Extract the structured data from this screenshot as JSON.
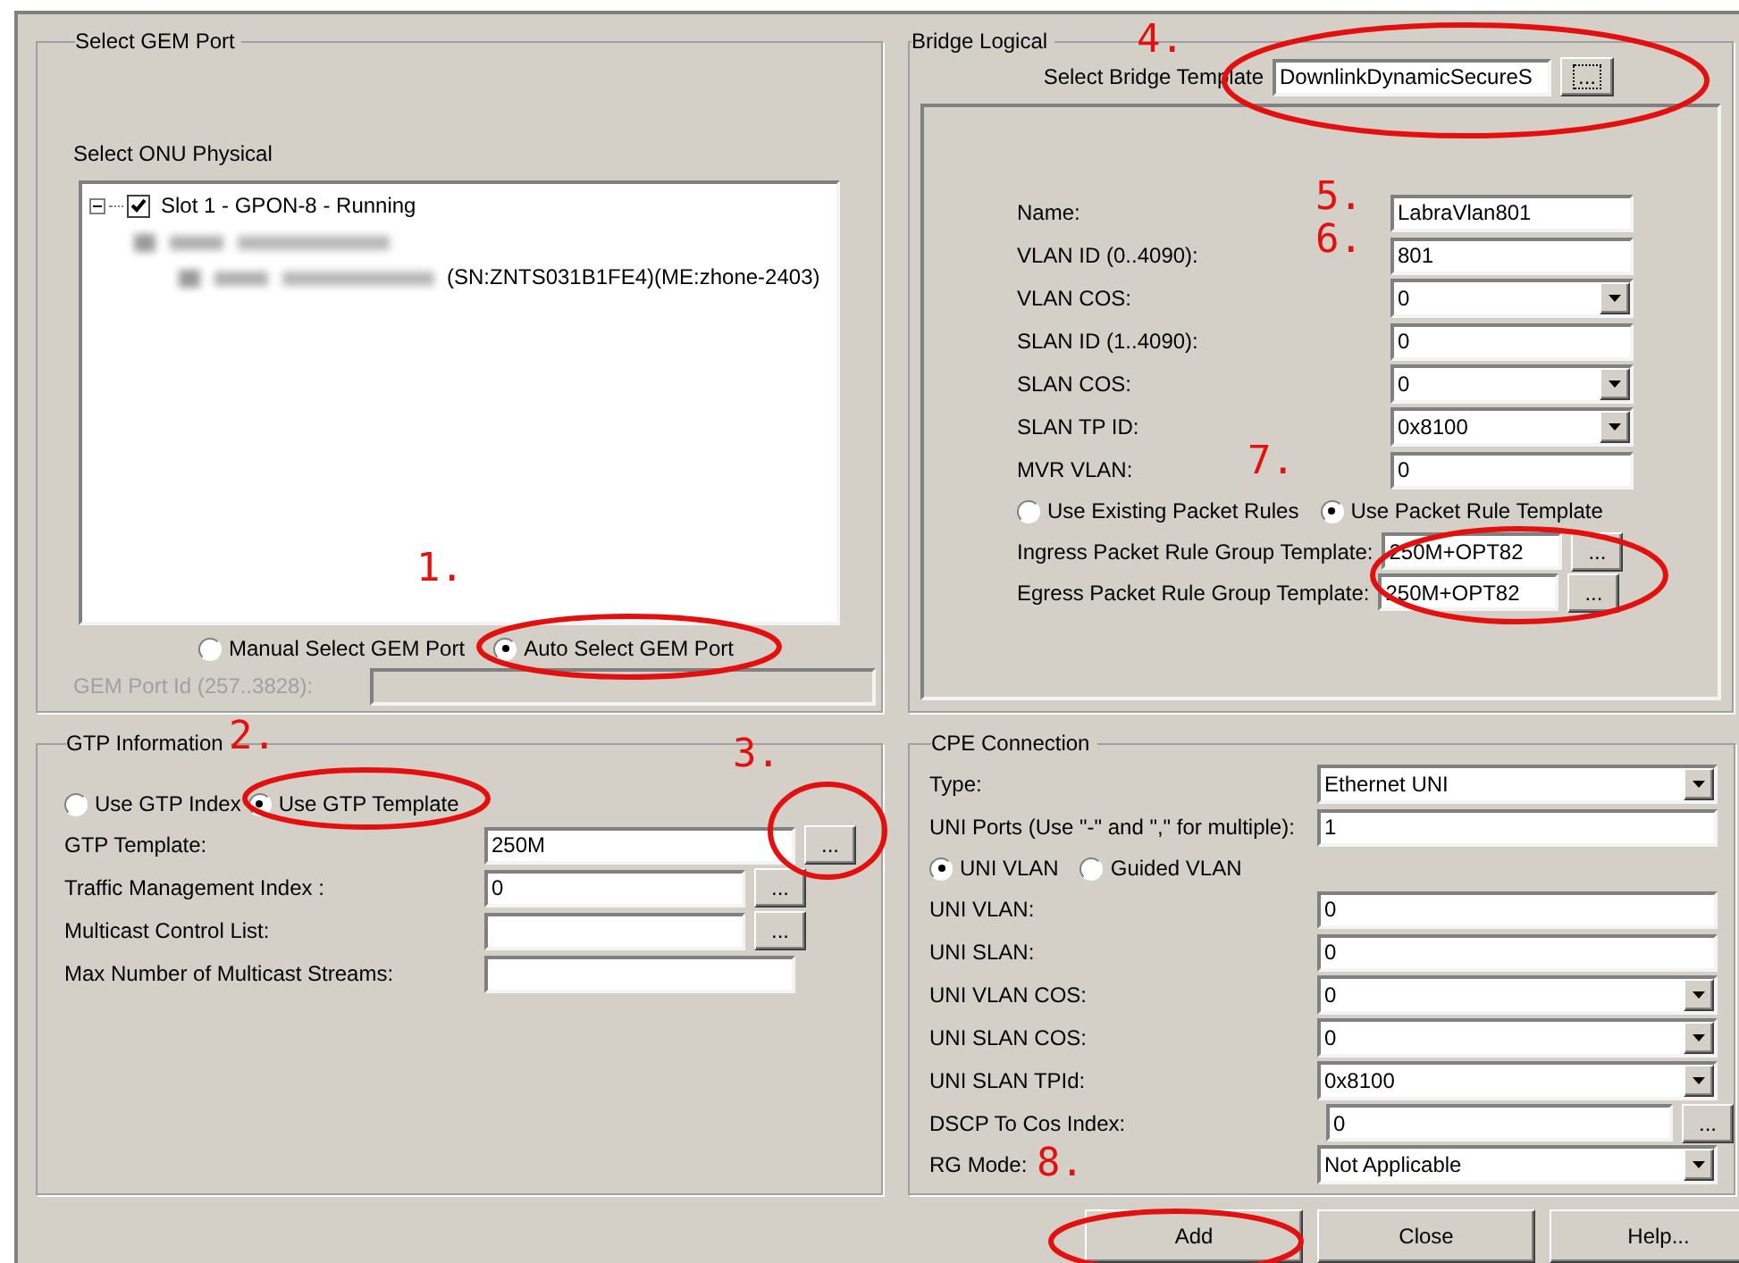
{
  "gem_port": {
    "title": "Select GEM Port",
    "tree_label": "Select ONU Physical",
    "tree": [
      {
        "label": "Slot 1 - GPON-8 - Running",
        "checked": true,
        "expanded": true,
        "children": [
          {
            "kind": "redacted",
            "children": [
              {
                "kind": "redacted",
                "suffix": "(SN:ZNTS031B1FE4)(ME:zhone-2403)"
              }
            ]
          }
        ]
      }
    ],
    "modes": [
      {
        "label": "Manual Select GEM Port",
        "selected": false
      },
      {
        "label": "Auto Select GEM Port",
        "selected": true
      }
    ],
    "port_id": {
      "label": "GEM Port Id (257..3828):",
      "disabled": true
    }
  },
  "gtp": {
    "title": "GTP Information",
    "modes": [
      {
        "label": "Use GTP Index",
        "selected": false
      },
      {
        "label": "Use GTP Template",
        "selected": true
      }
    ],
    "fields": [
      {
        "label": "GTP Template:",
        "value": "250M",
        "button": "..."
      },
      {
        "label": "Traffic Management Index :",
        "value": "0",
        "button": "..."
      },
      {
        "label": "Multicast Control List:",
        "button": "..."
      },
      {
        "label": "Max Number of Multicast Streams:"
      }
    ]
  },
  "bridge": {
    "title": "Bridge Logical",
    "template": {
      "label": "Select Bridge Template",
      "value": "DownlinkDynamicSecureS",
      "button": "..."
    },
    "fields": [
      {
        "kind": "text",
        "label": "Name:",
        "value": "LabraVlan801"
      },
      {
        "kind": "text",
        "label": "VLAN ID (0..4090):",
        "value": "801"
      },
      {
        "kind": "select",
        "label": "VLAN COS:",
        "value": "0"
      },
      {
        "kind": "text",
        "label": "SLAN ID (1..4090):",
        "value": "0"
      },
      {
        "kind": "select",
        "label": "SLAN COS:",
        "value": "0"
      },
      {
        "kind": "select",
        "label": "SLAN TP ID:",
        "value": "0x8100"
      },
      {
        "kind": "text",
        "label": "MVR VLAN:",
        "value": "0"
      },
      {
        "kind": "radios",
        "options": [
          {
            "label": "Use Existing Packet Rules",
            "selected": false
          },
          {
            "label": "Use Packet Rule Template",
            "selected": true
          }
        ]
      },
      {
        "kind": "browse",
        "label": "Ingress Packet Rule Group Template:",
        "value": "250M+OPT82",
        "button": "..."
      },
      {
        "kind": "browse",
        "label": "Egress Packet Rule Group Template:",
        "value": "250M+OPT82",
        "button": "..."
      }
    ]
  },
  "cpe": {
    "title": "CPE Connection",
    "fields": [
      {
        "kind": "select",
        "label": "Type:",
        "value": "Ethernet UNI"
      },
      {
        "kind": "text",
        "label": "UNI Ports (Use \"-\" and \",\" for multiple):",
        "value": "1"
      },
      {
        "kind": "radios",
        "options": [
          {
            "label": "UNI VLAN",
            "selected": true
          },
          {
            "label": "Guided VLAN",
            "selected": false
          }
        ]
      },
      {
        "kind": "text",
        "label": "UNI VLAN:",
        "value": "0"
      },
      {
        "kind": "text",
        "label": "UNI SLAN:",
        "value": "0"
      },
      {
        "kind": "select",
        "label": "UNI VLAN COS:",
        "value": "0"
      },
      {
        "kind": "select",
        "label": "UNI SLAN COS:",
        "value": "0"
      },
      {
        "kind": "select",
        "label": "UNI SLAN TPId:",
        "value": "0x8100"
      },
      {
        "kind": "browse",
        "label": "DSCP To Cos Index:",
        "value": "0",
        "button": "..."
      },
      {
        "kind": "select",
        "label": "RG Mode:",
        "value": "Not Applicable"
      }
    ]
  },
  "buttons": [
    {
      "label": "Add"
    },
    {
      "label": "Close"
    },
    {
      "label": "Help..."
    }
  ],
  "annotations": [
    "1.",
    "2.",
    "3.",
    "4.",
    "5.",
    "6.",
    "7.",
    "8."
  ]
}
